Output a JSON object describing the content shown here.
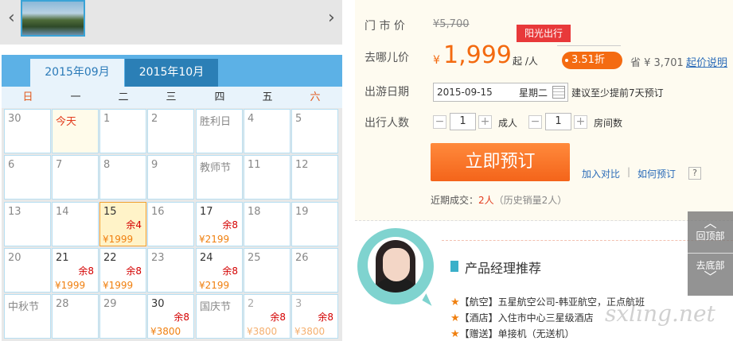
{
  "gallery": {
    "prev_icon": "‹",
    "next_icon": "›"
  },
  "calendar": {
    "tabs": [
      "2015年09月",
      "2015年10月"
    ],
    "weekdays": [
      "日",
      "一",
      "二",
      "三",
      "四",
      "五",
      "六"
    ],
    "rows": [
      [
        {
          "d": "30"
        },
        {
          "d": "今天",
          "today": true
        },
        {
          "d": "1"
        },
        {
          "d": "2"
        },
        {
          "d": "胜利日"
        },
        {
          "d": "4"
        },
        {
          "d": "5"
        }
      ],
      [
        {
          "d": "6"
        },
        {
          "d": "7"
        },
        {
          "d": "8"
        },
        {
          "d": "9"
        },
        {
          "d": "教师节"
        },
        {
          "d": "11"
        },
        {
          "d": "12"
        }
      ],
      [
        {
          "d": "13"
        },
        {
          "d": "14"
        },
        {
          "d": "15",
          "r": "余4",
          "p": "¥1999",
          "sel": true
        },
        {
          "d": "16"
        },
        {
          "d": "17",
          "r": "余8",
          "p": "¥2199"
        },
        {
          "d": "18"
        },
        {
          "d": "19"
        }
      ],
      [
        {
          "d": "20"
        },
        {
          "d": "21",
          "r": "余8",
          "p": "¥1999"
        },
        {
          "d": "22",
          "r": "余8",
          "p": "¥1999"
        },
        {
          "d": "23"
        },
        {
          "d": "24",
          "r": "余8",
          "p": "¥2199"
        },
        {
          "d": "25"
        },
        {
          "d": "26"
        }
      ],
      [
        {
          "d": "中秋节"
        },
        {
          "d": "28"
        },
        {
          "d": "29"
        },
        {
          "d": "30",
          "r": "余8",
          "p": "¥3800"
        },
        {
          "d": "国庆节"
        },
        {
          "d": "2",
          "r": "余8",
          "p": "¥3800",
          "fade": true
        },
        {
          "d": "3",
          "r": "余8",
          "p": "¥3800",
          "fade": true
        }
      ]
    ]
  },
  "info": {
    "list_label": "门 市 价",
    "list_price": "¥5,700",
    "badge": "阳光出行",
    "qunar_label": "去哪儿价",
    "yen": "¥",
    "price": "1,999",
    "per": "起 /人",
    "discount": "3.51折",
    "save": "省 ¥ 3,701",
    "save_link": "起价说明",
    "date_label": "出游日期",
    "date_value": "2015-09-15",
    "weekday": "星期二",
    "advice": "建议至少提前7天预订",
    "people_label": "出行人数",
    "minus": "−",
    "plus": "+",
    "adults": "1",
    "adult_unit": "成人",
    "rooms": "1",
    "room_unit": "房间数",
    "book": "立即预订",
    "compare": "加入对比",
    "separator": "|",
    "howto": "如何预订",
    "help": "?",
    "recent_label": "近期成交：",
    "recent_count": "2人",
    "history": "（历史销量2人）"
  },
  "manager": {
    "title": "产品经理推荐",
    "items": [
      {
        "star": "★",
        "text": "【航空】五星航空公司-韩亚航空，正点航班"
      },
      {
        "star": "★",
        "text": "【酒店】入住市中心三星级酒店"
      },
      {
        "star": "★",
        "text": "【赠送】单接机（无送机）"
      }
    ]
  },
  "scroll": {
    "top": "回顶部",
    "bottom": "去底部",
    "up_icon": "︿",
    "down_icon": "﹀"
  },
  "watermark": "sxling.net",
  "colors": {
    "accent": "#f36a10",
    "tab_blue": "#2b7fb6",
    "link": "#2a6bb8"
  }
}
